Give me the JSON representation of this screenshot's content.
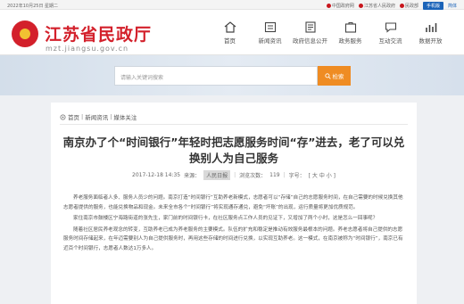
{
  "topbar": {
    "date": "2022年10月25日 星期二",
    "links": [
      {
        "label": "中国政府网",
        "icon": "national-emblem-icon"
      },
      {
        "label": "江苏省人民政府",
        "icon": "provincial-emblem-icon"
      },
      {
        "label": "民政部",
        "icon": "ministry-emblem-icon"
      }
    ],
    "mobile": "手机版",
    "lang": "简体"
  },
  "brand": {
    "title": "江苏省民政厅",
    "url": "mzt.jiangsu.gov.cn",
    "color": "#d3202b"
  },
  "nav": [
    {
      "label": "首页",
      "icon": "home-icon"
    },
    {
      "label": "新闻资讯",
      "icon": "news-icon"
    },
    {
      "label": "政府信息公开",
      "icon": "info-disclosure-icon"
    },
    {
      "label": "政务服务",
      "icon": "government-service-icon"
    },
    {
      "label": "互动交流",
      "icon": "interaction-icon"
    },
    {
      "label": "数据开放",
      "icon": "data-open-icon"
    }
  ],
  "search": {
    "placeholder": "请输入关键词搜索",
    "button": "检索",
    "accent": "#ef8c23"
  },
  "breadcrumb": [
    "首页",
    "新闻资讯",
    "媒体关注"
  ],
  "article": {
    "title": "南京办了个“时间银行”年轻时把志愿服务时间“存”进去，老了可以兑换别人为自己服务",
    "date": "2017-12-18 14:35",
    "source_label": "来源：",
    "source": "人民日报",
    "views_label": "浏览次数：",
    "views": "119",
    "font_label": "字号：",
    "font_sizes": "[ 大 中 小 ]",
    "paragraphs": [
      "养老服务面临者人多、服务人员少的问题。南京打造“时间银行”互助养老新模式，志愿者可以“存储”自己的志愿服务时间，在自己需要的时候兑换其他志愿者提供的服务，也能兑换物品和现金。未来全市各个“时间银行”将实现通存通兑，避免“坏账”的出现，运行质量将更加优质规范。",
      "家住南京市鼓楼区宁海路街道的张先生，家门前的时间银行卡，在社区服务点工作人员的见证下，又增加了两个小时，这是怎么一回事呢？",
      "随着社区居民养老观念的转变，互助养老已成为养老服务的主要模式。队伍的扩充和稳定是推动有效服务最根本的问题。养老志愿者将自己提供的志愿服务时间存储起来，在年迈需要别人为自己提供服务时，再用这些存储的时间进行兑换，以实现互助养老。这一模式，在南京被称为“时间银行”，南京已有近百个时间银行，志愿者人数达1万多人。"
    ]
  }
}
